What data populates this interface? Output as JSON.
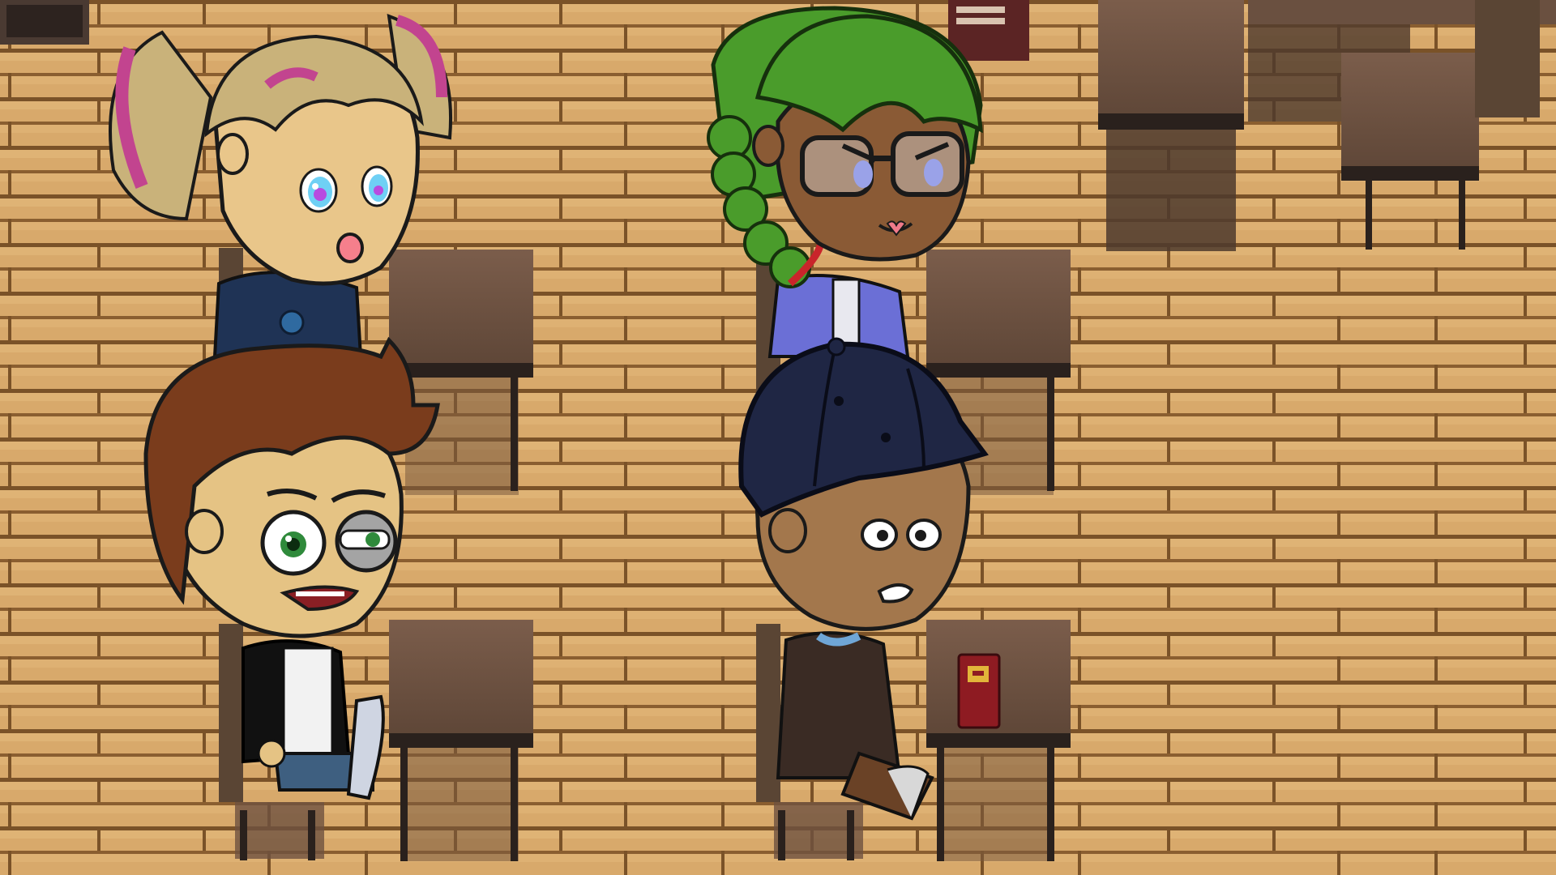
{
  "scene": {
    "type": "top-down classroom scene",
    "palette": {
      "floor_light": "#d9aa6c",
      "floor_mid": "#c7965a",
      "floor_dark": "#7a5228",
      "desk_top": "#6f5444",
      "desk_edge": "#2a211d",
      "chair": "#5a4534"
    },
    "characters": [
      {
        "id": "pigtails-girl",
        "hair": "#c9b27a",
        "hair_accent": "#c2448f",
        "eyes": "#7fd6ff",
        "outfit": "#2a3e63",
        "skin": "#e9c68a"
      },
      {
        "id": "green-hair-girl",
        "hair": "#4a9c2b",
        "eyes": "#9aa2e8",
        "outfit": "#6b6fd6",
        "skin": "#8a5a35"
      },
      {
        "id": "brown-hair-boy",
        "hair": "#7a3c1c",
        "eyes": "#2f8a3b",
        "outfit": "#111111",
        "skin": "#e5c384"
      },
      {
        "id": "cap-boy",
        "hair": "#1f2644",
        "eyes": "#1a1a1a",
        "outfit": "#3a2b24",
        "skin": "#a3774c"
      }
    ],
    "items": [
      {
        "id": "red-book",
        "color": "#8e1b22",
        "accent": "#e2b53a"
      }
    ]
  }
}
